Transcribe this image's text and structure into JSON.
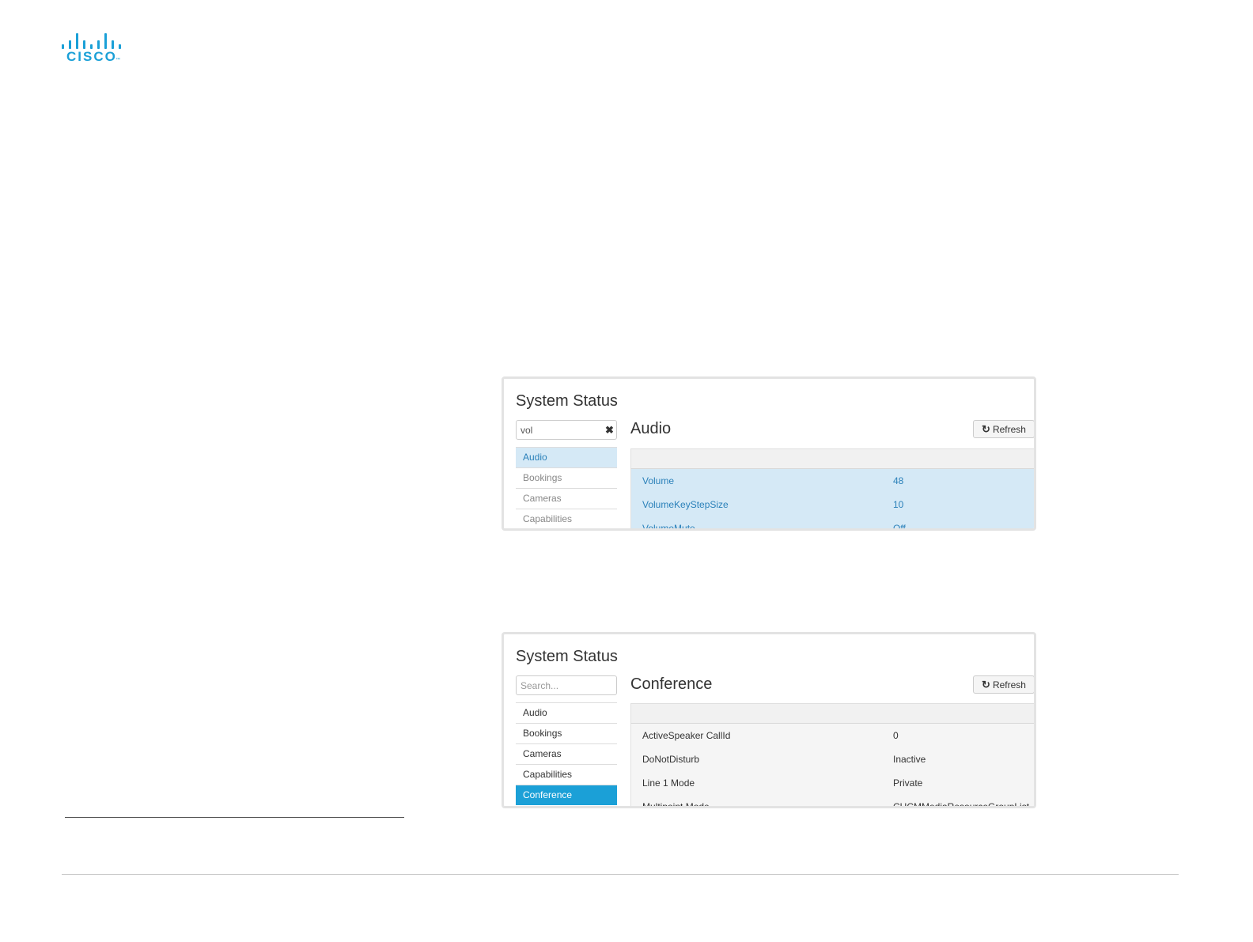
{
  "brand": {
    "logo_text": "CISCO",
    "color": "#1ba0d7"
  },
  "screens": [
    {
      "title": "System Status",
      "search": {
        "value": "vol",
        "placeholder": "Search..."
      },
      "nav": [
        "Audio",
        "Bookings",
        "Cameras",
        "Capabilities"
      ],
      "section": "Audio",
      "refresh_label": "Refresh",
      "rows": [
        {
          "key": "Volume",
          "value": "48"
        },
        {
          "key": "VolumeKeyStepSize",
          "value": "10"
        },
        {
          "key": "VolumeMute",
          "value": "Off"
        }
      ]
    },
    {
      "title": "System Status",
      "search": {
        "value": "",
        "placeholder": "Search..."
      },
      "nav": [
        "Audio",
        "Bookings",
        "Cameras",
        "Capabilities",
        "Conference"
      ],
      "section": "Conference",
      "refresh_label": "Refresh",
      "rows": [
        {
          "key": "ActiveSpeaker CallId",
          "value": "0"
        },
        {
          "key": "DoNotDisturb",
          "value": "Inactive"
        },
        {
          "key": "Line 1 Mode",
          "value": "Private"
        },
        {
          "key": "Multipoint Mode",
          "value": "CUCMMediaResourceGroupList"
        }
      ]
    }
  ]
}
